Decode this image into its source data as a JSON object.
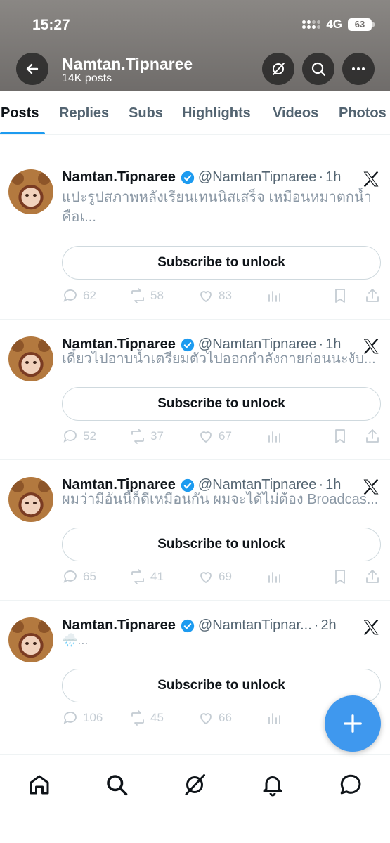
{
  "status_bar": {
    "time": "15:27",
    "network": "4G",
    "battery": "63"
  },
  "header": {
    "name": "Namtan.Tipnaree",
    "post_count": "14K posts"
  },
  "tabs": [
    {
      "label": "Posts",
      "active": true
    },
    {
      "label": "Replies"
    },
    {
      "label": "Subs"
    },
    {
      "label": "Highlights"
    },
    {
      "label": "Videos"
    },
    {
      "label": "Photos"
    }
  ],
  "posts": [
    {
      "name": "Namtan.Tipnaree",
      "handle": "@NamtanTipnaree",
      "dot": "·",
      "time": "1h",
      "text": "แปะรูปสภาพหลังเรียนเทนนิสเสร็จ เหมือนหมาตกน้ำคือเ...",
      "subscribe_label": "Subscribe to unlock",
      "replies": "62",
      "reposts": "58",
      "likes": "83"
    },
    {
      "name": "Namtan.Tipnaree",
      "handle": "@NamtanTipnaree",
      "dot": "·",
      "time": "1h",
      "text": "เดี๋ยวไปอาบน้ำเตรียมตัวไปออกกำลังกายก่อนนะงับ...",
      "subscribe_label": "Subscribe to unlock",
      "replies": "52",
      "reposts": "37",
      "likes": "67"
    },
    {
      "name": "Namtan.Tipnaree",
      "handle": "@NamtanTipnaree",
      "dot": "·",
      "time": "1h",
      "text": "ผมว่ามีอันนี้ก็ดีเหมือนกัน ผมจะได้ไม่ต้อง Broadcas...",
      "subscribe_label": "Subscribe to unlock",
      "replies": "65",
      "reposts": "41",
      "likes": "69"
    },
    {
      "name": "Namtan.Tipnaree",
      "handle": "@NamtanTipnar...",
      "dot": "·",
      "time": "2h",
      "text": "🌧️...",
      "subscribe_label": "Subscribe to unlock",
      "replies": "106",
      "reposts": "45",
      "likes": "66"
    }
  ],
  "colors": {
    "accent": "#1d9bf0",
    "fab": "#3f98ee",
    "header": "#7a7775"
  }
}
